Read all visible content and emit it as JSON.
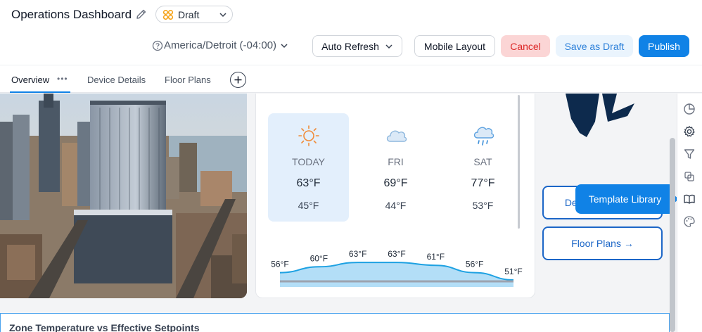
{
  "header": {
    "title": "Operations Dashboard",
    "status": "Draft",
    "timezone": "America/Detroit (-04:00)",
    "buttons": {
      "auto_refresh": "Auto Refresh",
      "mobile_layout": "Mobile Layout",
      "cancel": "Cancel",
      "save_draft": "Save as Draft",
      "publish": "Publish"
    }
  },
  "tabs": {
    "overview": "Overview",
    "overview_menu": "•••",
    "device_details": "Device Details",
    "floor_plans": "Floor Plans"
  },
  "weather": {
    "days": [
      {
        "name": "TODAY",
        "high": "63°F",
        "low": "45°F",
        "icon": "sun-icon"
      },
      {
        "name": "FRI",
        "high": "69°F",
        "low": "44°F",
        "icon": "cloud-icon"
      },
      {
        "name": "SAT",
        "high": "77°F",
        "low": "53°F",
        "icon": "rain-cloud-icon"
      }
    ],
    "hourly_temps": [
      "56°F",
      "60°F",
      "63°F",
      "63°F",
      "61°F",
      "56°F",
      "51°F"
    ],
    "hourly_values": [
      56,
      60,
      63,
      63,
      61,
      56,
      51
    ]
  },
  "links": {
    "device_details": "Device Details →",
    "floor_plans": "Floor Plans →"
  },
  "tooltip": {
    "template_library": "Template Library"
  },
  "rail_icons": [
    "pie-chart-icon",
    "gear-icon",
    "filter-icon",
    "swap-icon",
    "book-icon",
    "palette-icon"
  ],
  "zone": {
    "title": "Zone Temperature vs Effective Setpoints"
  },
  "colors": {
    "accent": "#1082e6",
    "cancel_bg": "#fbd5d5",
    "cancel_text": "#dc2626",
    "logo": "#0d2a4d"
  }
}
